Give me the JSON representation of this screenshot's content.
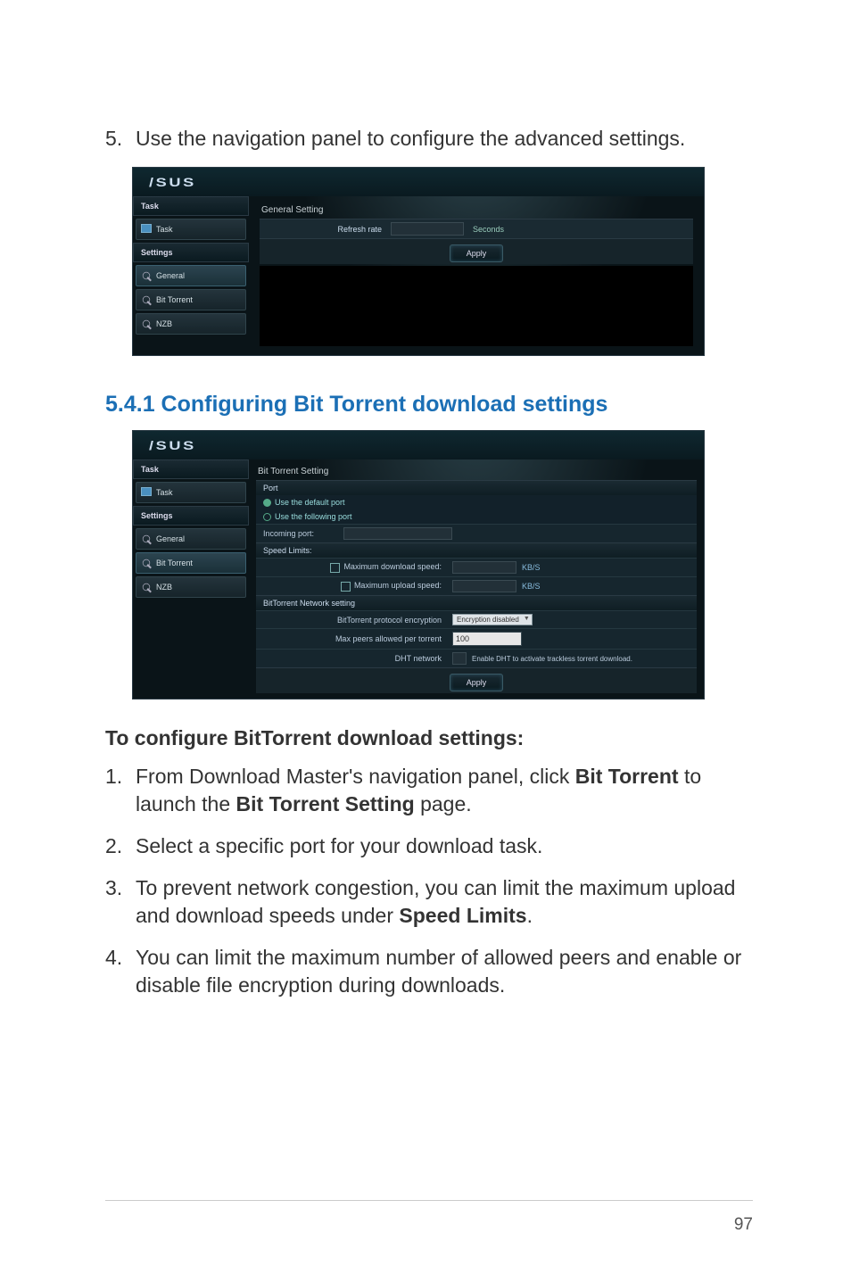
{
  "step5": {
    "num": "5.",
    "text": "Use the navigation panel to configure the advanced settings."
  },
  "ss1": {
    "logo": "/SUS",
    "sidebar": {
      "task_header": "Task",
      "task_item": "Task",
      "settings_header": "Settings",
      "items": [
        "General",
        "Bit Torrent",
        "NZB"
      ]
    },
    "panel": {
      "title": "General Setting",
      "refresh_label": "Refresh rate",
      "refresh_unit": "Seconds",
      "apply": "Apply"
    }
  },
  "section_heading": "5.4.1  Configuring Bit Torrent download settings",
  "ss2": {
    "logo": "/SUS",
    "sidebar": {
      "task_header": "Task",
      "task_item": "Task",
      "settings_header": "Settings",
      "items": [
        "General",
        "Bit Torrent",
        "NZB"
      ]
    },
    "panel": {
      "title": "Bit Torrent Setting",
      "port_header": "Port",
      "radio1": "Use the default port",
      "radio2": "Use the following port",
      "incoming_port": "Incoming port:",
      "speed_header": "Speed Limits:",
      "dl_label": "Maximum download speed:",
      "ul_label": "Maximum upload speed:",
      "unit": "KB/S",
      "net_header": "BitTorrent Network setting",
      "enc_label": "BitTorrent protocol encryption",
      "enc_value": "Encryption disabled",
      "peers_label": "Max peers allowed per torrent",
      "peers_value": "100",
      "dht_label": "DHT network",
      "dht_note": "Enable DHT to activate trackless torrent download.",
      "apply": "Apply"
    }
  },
  "sub_heading": "To configure BitTorrent download settings:",
  "steps": {
    "s1": {
      "num": "1.",
      "pre": "From Download Master's navigation panel, click ",
      "b1": "Bit Torrent",
      "mid": " to launch the ",
      "b2": "Bit Torrent Setting",
      "post": " page."
    },
    "s2": {
      "num": "2.",
      "text": "Select a specific port for your download task."
    },
    "s3": {
      "num": "3.",
      "pre": "To prevent network congestion, you can limit the maximum upload and download speeds under ",
      "b": "Speed Limits",
      "post": "."
    },
    "s4": {
      "num": "4.",
      "text": "You can limit the maximum number of allowed peers and enable or disable file encryption during downloads."
    }
  },
  "page_number": "97"
}
